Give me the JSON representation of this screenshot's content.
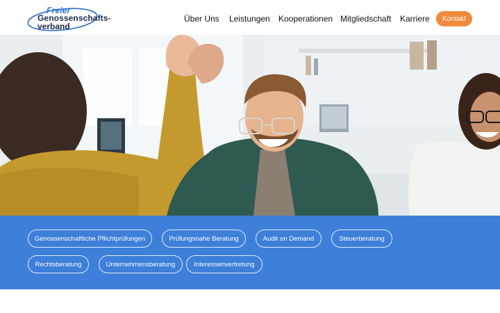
{
  "logo": {
    "line1": "Freier",
    "line2": "Genossenschafts-",
    "line3": "verband"
  },
  "nav": {
    "items": [
      {
        "label": "Über Uns"
      },
      {
        "label": "Leistungen"
      },
      {
        "label": "Kooperationen"
      },
      {
        "label": "Mitgliedschaft"
      },
      {
        "label": "Karriere"
      }
    ],
    "contact_label": "Kontakt"
  },
  "colors": {
    "brand_blue": "#3d7fd9",
    "accent_orange": "#f08a3c",
    "logo_dark": "#1e2a4a"
  },
  "services": {
    "pills": [
      {
        "label": "Genossenschaftliche Pflichtprüfungen"
      },
      {
        "label": "Prüfungsnahe Beratung"
      },
      {
        "label": "Audit on Demand"
      },
      {
        "label": "Steuerberatung"
      },
      {
        "label": "Rechtsberatung"
      },
      {
        "label": "Unternehmensberatung"
      },
      {
        "label": "Interessenvertretung"
      }
    ]
  }
}
